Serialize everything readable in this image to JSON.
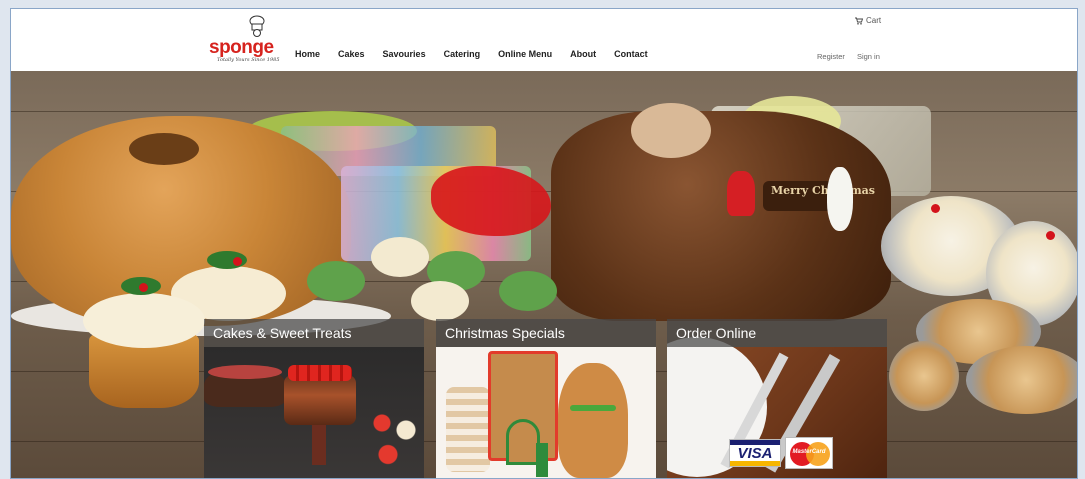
{
  "brand": {
    "name": "sponge",
    "tagline": "Totally Yours Since 1985",
    "accent_color": "#d6231e"
  },
  "nav": {
    "items": [
      "Home",
      "Cakes",
      "Savouries",
      "Catering",
      "Online Menu",
      "About",
      "Contact"
    ]
  },
  "header": {
    "cart_label": "Cart",
    "cart_icon": "cart-icon",
    "register_label": "Register",
    "signin_label": "Sign in"
  },
  "hero": {
    "plaque_text": "Merry Christmas"
  },
  "cards": [
    {
      "title": "Cakes & Sweet Treats"
    },
    {
      "title": "Christmas Specials"
    },
    {
      "title": "Order Online"
    }
  ],
  "payment": {
    "visa_label": "VISA",
    "mastercard_label": "MasterCard"
  }
}
